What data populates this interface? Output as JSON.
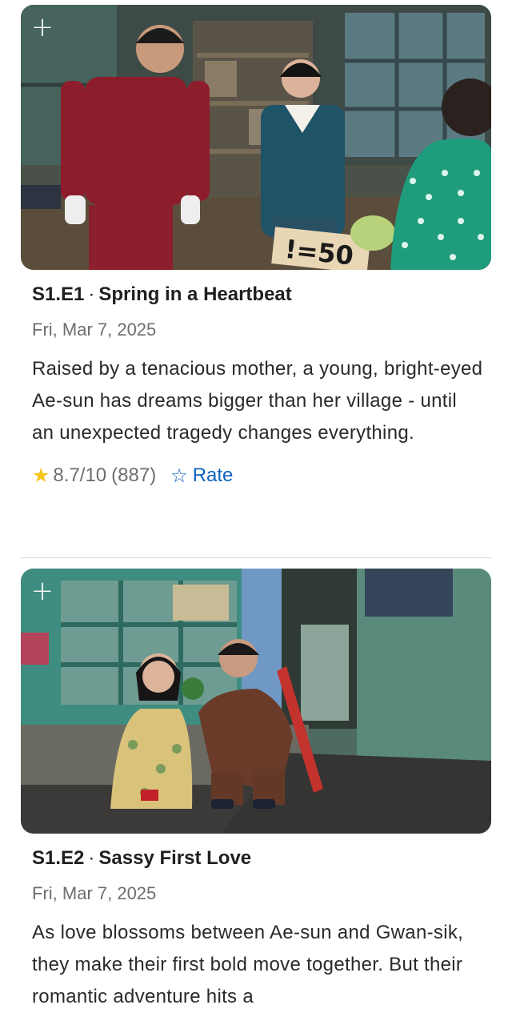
{
  "episodes": [
    {
      "add_icon": "plus-icon",
      "add_glyph": "+",
      "code": "S1.E1",
      "separator": "·",
      "title": "Spring in a Heartbeat",
      "date": "Fri, Mar 7, 2025",
      "description": "Raised by a tenacious mother, a young, bright-eyed Ae-sun has dreams bigger than her village - until an unexpected tragedy changes everything.",
      "rating": "8.7/10",
      "votes": "(887)",
      "rate_label": "Rate",
      "sign_text": "!=50"
    },
    {
      "add_icon": "plus-icon",
      "add_glyph": "+",
      "code": "S1.E2",
      "separator": "·",
      "title": "Sassy First Love",
      "date": "Fri, Mar 7, 2025",
      "description": "As love blossoms between Ae-sun and Gwan-sik, they make their first bold move together. But their romantic adventure hits a"
    }
  ],
  "icons": {
    "rating_star": "star-filled-icon",
    "rate_star": "star-outline-icon",
    "star_filled_glyph": "★",
    "star_outline_glyph": "☆"
  },
  "colors": {
    "accent_link": "#0e63be",
    "rating_star": "#f5c518",
    "muted_text": "#6e6e6e"
  }
}
